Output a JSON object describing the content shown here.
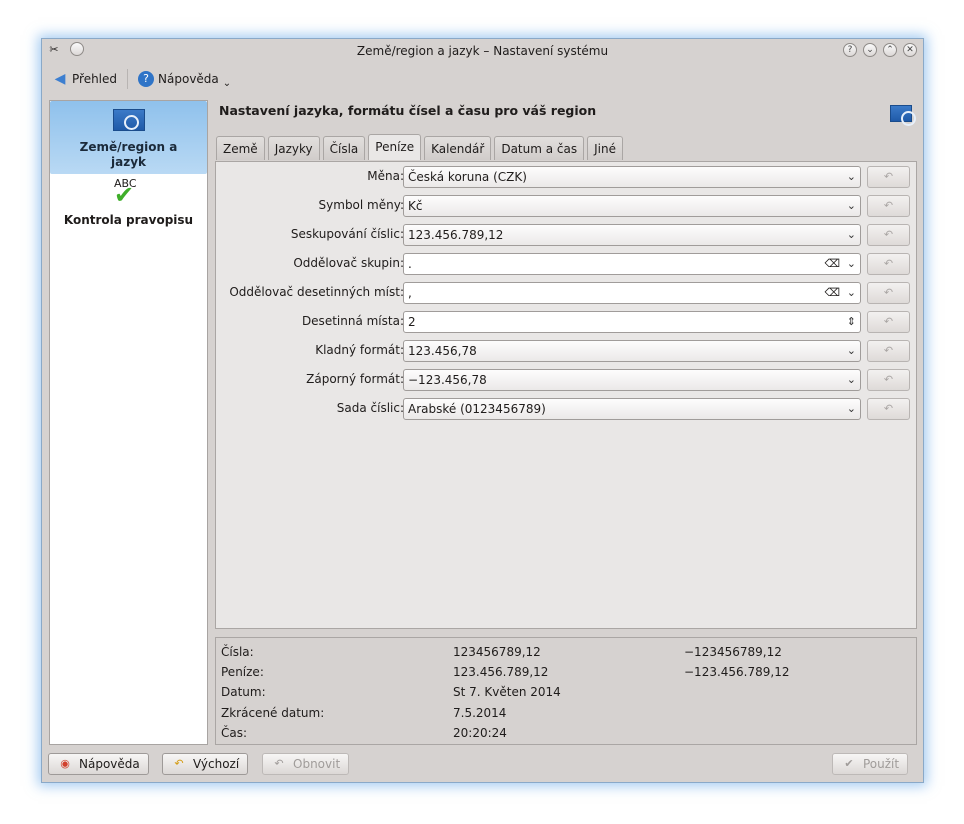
{
  "window": {
    "title": "Země/region a jazyk – Nastavení systému"
  },
  "toolbar": {
    "overview": "Přehled",
    "help": "Nápověda"
  },
  "sidebar": {
    "items": [
      {
        "label": "Země/region a jazyk"
      },
      {
        "label": "Kontrola pravopisu",
        "icon_text": "ABC"
      }
    ]
  },
  "heading": "Nastavení jazyka, formátu čísel a času pro váš region",
  "tabs": [
    {
      "label": "Země"
    },
    {
      "label": "Jazyky"
    },
    {
      "label": "Čísla"
    },
    {
      "label": "Peníze"
    },
    {
      "label": "Kalendář"
    },
    {
      "label": "Datum a čas"
    },
    {
      "label": "Jiné"
    }
  ],
  "form": [
    {
      "label": "Měna:",
      "value": "Česká koruna (CZK)"
    },
    {
      "label": "Symbol měny:",
      "value": "Kč"
    },
    {
      "label": "Seskupování číslic:",
      "value": "123.456.789,12"
    },
    {
      "label": "Oddělovač skupin:",
      "value": "."
    },
    {
      "label": "Oddělovač desetinných míst:",
      "value": ","
    },
    {
      "label": "Desetinná místa:",
      "value": "2"
    },
    {
      "label": "Kladný formát:",
      "value": "123.456,78"
    },
    {
      "label": "Záporný formát:",
      "value": "−123.456,78"
    },
    {
      "label": "Sada číslic:",
      "value": "Arabské (0123456789)"
    }
  ],
  "preview": {
    "labels": [
      "Čísla:",
      "Peníze:",
      "Datum:",
      "Zkrácené datum:",
      "Čas:"
    ],
    "col1": [
      "123456789,12",
      "123.456.789,12",
      "St 7. Květen 2014",
      "7.5.2014",
      "20:20:24"
    ],
    "col2": [
      "−123456789,12",
      "−123.456.789,12"
    ]
  },
  "buttons": {
    "help": "Nápověda",
    "defaults": "Výchozí",
    "reset": "Obnovit",
    "apply": "Použít"
  }
}
